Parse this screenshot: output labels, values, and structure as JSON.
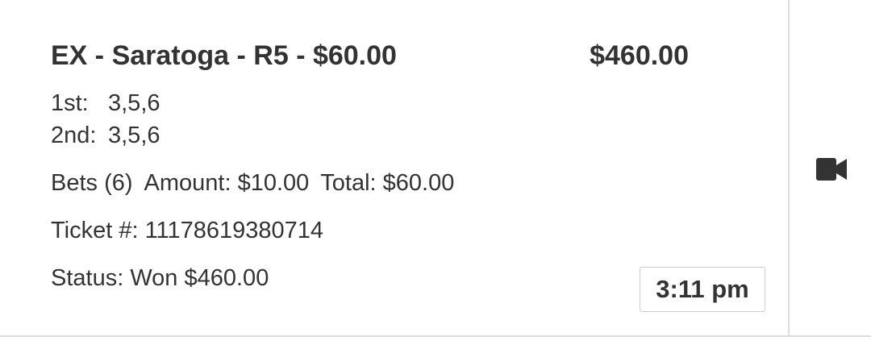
{
  "colors": {
    "accent": "#4ab41e",
    "text": "#333333",
    "divider": "#dddddd"
  },
  "ticket": {
    "title": "EX - Saratoga - R5 - $60.00",
    "payout": "$460.00",
    "selections": [
      {
        "label": "1st:",
        "value": "3,5,6"
      },
      {
        "label": "2nd:",
        "value": "3,5,6"
      }
    ],
    "bets_label": "Bets (6)",
    "amount_label": "Amount: $10.00",
    "total_label": "Total: $60.00",
    "ticket_number": "Ticket #: 11178619380714",
    "status": "Status: Won $460.00",
    "time": "3:11 pm"
  },
  "side": {
    "icon": "video-camera-icon"
  }
}
